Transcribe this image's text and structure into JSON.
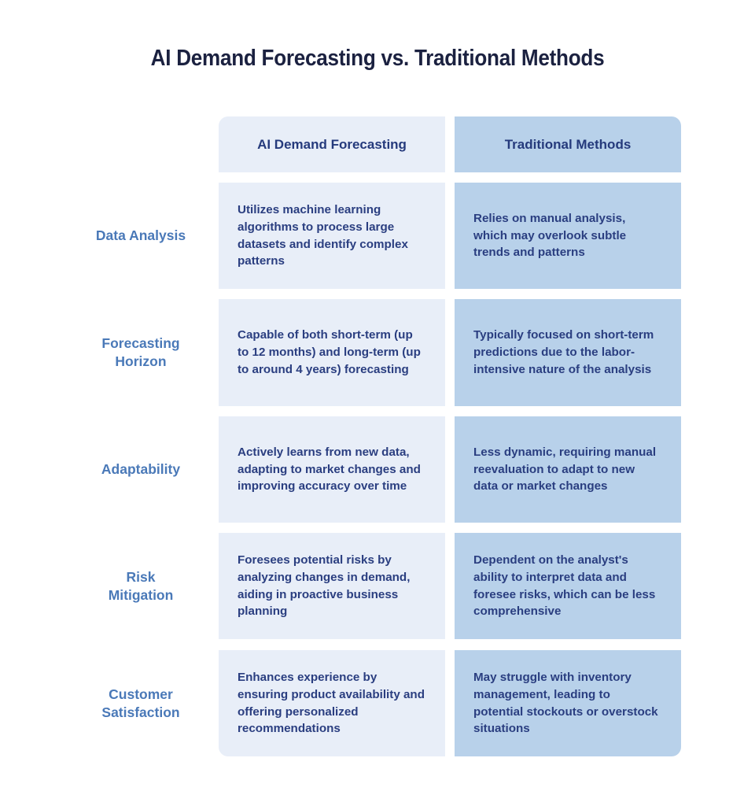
{
  "title": "AI Demand Forecasting vs. Traditional Methods",
  "columns": {
    "ai": "AI Demand Forecasting",
    "traditional": "Traditional Methods"
  },
  "colors": {
    "title": "#1b2140",
    "ai_bg": "#e8eef8",
    "traditional_bg": "#b8d1ea",
    "label": "#4a79b8",
    "cell_text": "#2a3e80"
  },
  "rows": [
    {
      "label": "Data Analysis",
      "ai": "Utilizes machine learning algorithms to process large datasets and identify complex patterns",
      "traditional": "Relies on manual analysis, which may overlook subtle trends and patterns"
    },
    {
      "label": "Forecasting Horizon",
      "ai": "Capable of both short-term (up to 12 months) and long-term (up to around 4 years) forecasting",
      "traditional": "Typically focused on short-term predictions due to the labor-intensive nature of the analysis"
    },
    {
      "label": "Adaptability",
      "ai": "Actively learns from new data, adapting to market changes and improving accuracy over time",
      "traditional": "Less dynamic, requiring manual reevaluation to adapt to new data or market changes"
    },
    {
      "label": "Risk Mitigation",
      "ai": "Foresees potential risks by analyzing changes in demand, aiding in proactive business planning",
      "traditional": "Dependent on the analyst's ability to interpret data and foresee risks, which can be less comprehensive"
    },
    {
      "label": "Customer Satisfaction",
      "ai": "Enhances experience by ensuring product availability and offering personalized recommendations",
      "traditional": "May struggle with inventory management, leading to potential stockouts or overstock situations"
    }
  ]
}
